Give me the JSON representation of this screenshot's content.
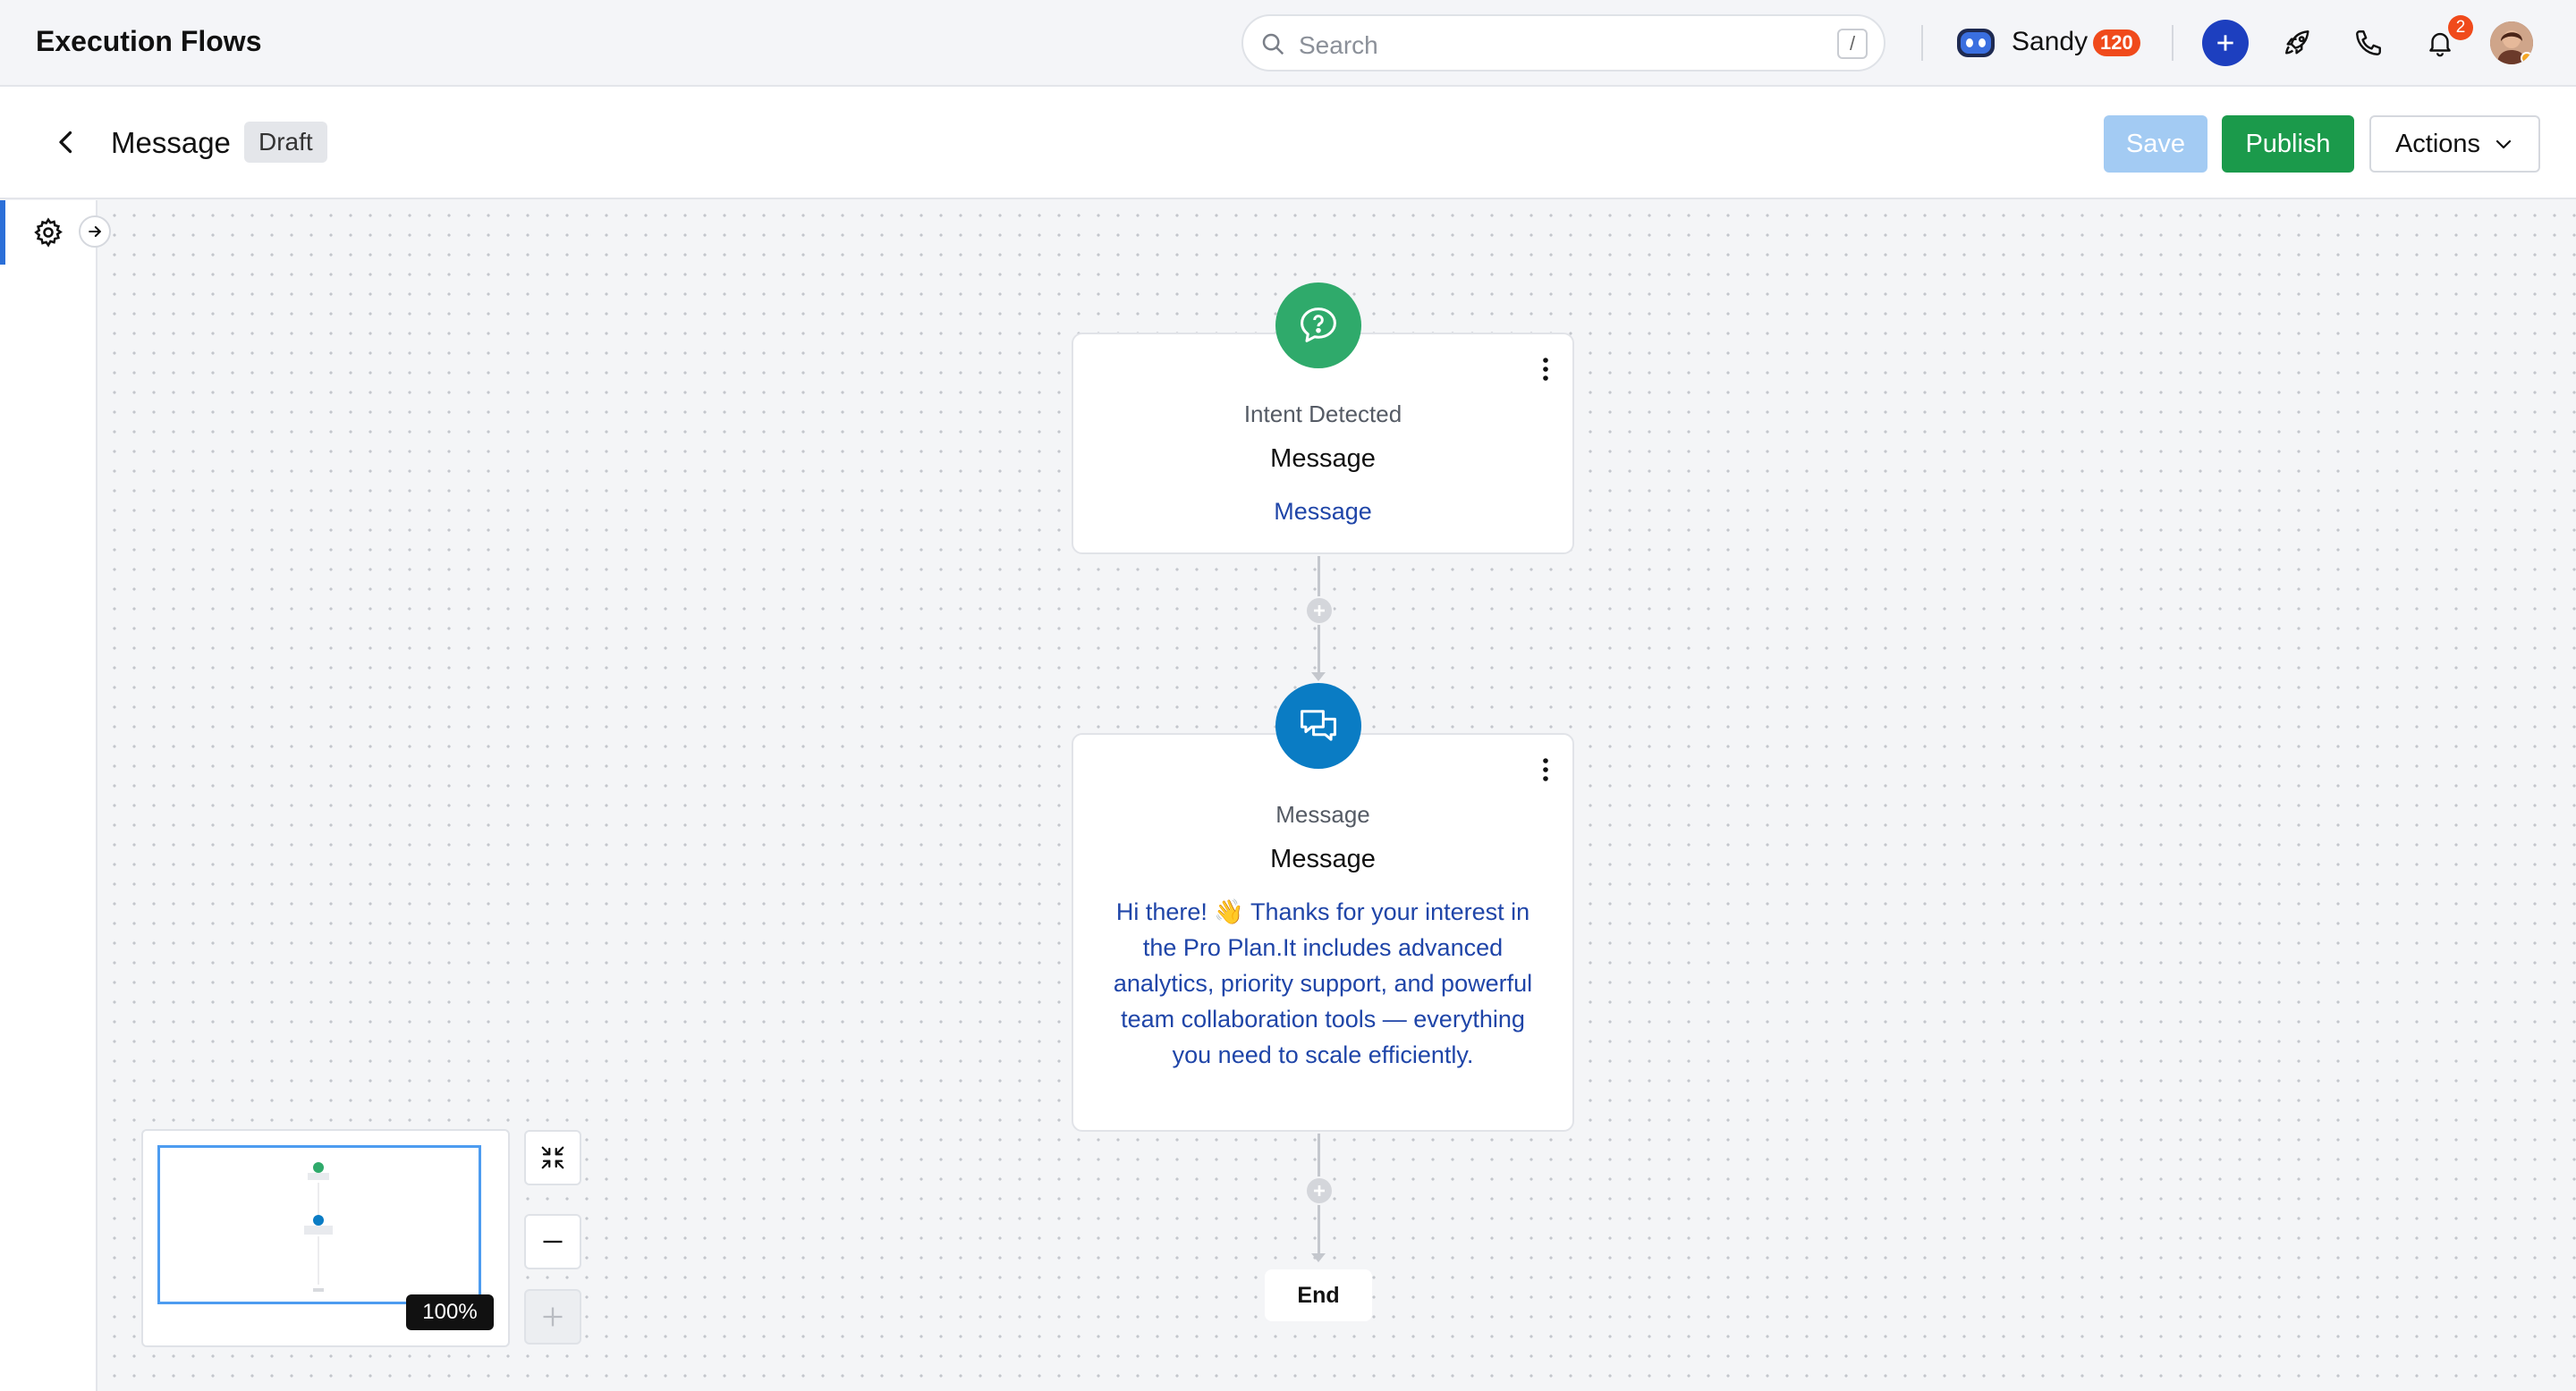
{
  "app": {
    "title": "Execution Flows"
  },
  "search": {
    "placeholder": "Search",
    "shortcut": "/"
  },
  "user": {
    "name": "Sandy",
    "badge_count": "120"
  },
  "notifications": {
    "count": "2"
  },
  "flow": {
    "name": "Message",
    "status": "Draft"
  },
  "toolbar": {
    "save_label": "Save",
    "publish_label": "Publish",
    "actions_label": "Actions"
  },
  "nodes": [
    {
      "type_label": "Intent Detected",
      "title": "Message",
      "body": "Message",
      "icon": "help-chat-icon",
      "color": "#2faa6b"
    },
    {
      "type_label": "Message",
      "title": "Message",
      "body": "Hi there! 👋 Thanks for your interest in the Pro Plan.It includes advanced analytics, priority support, and powerful team collaboration tools — everything you need to scale efficiently.",
      "icon": "chat-bubbles-icon",
      "color": "#0a7cc4"
    }
  ],
  "end_node": {
    "label": "End"
  },
  "zoom": {
    "level": "100%"
  },
  "colors": {
    "accent": "#2b6fd8",
    "publish": "#1b9a4b",
    "save_disabled": "#a3cbf3",
    "badge": "#f04a1b",
    "link_text": "#1f45a8"
  }
}
